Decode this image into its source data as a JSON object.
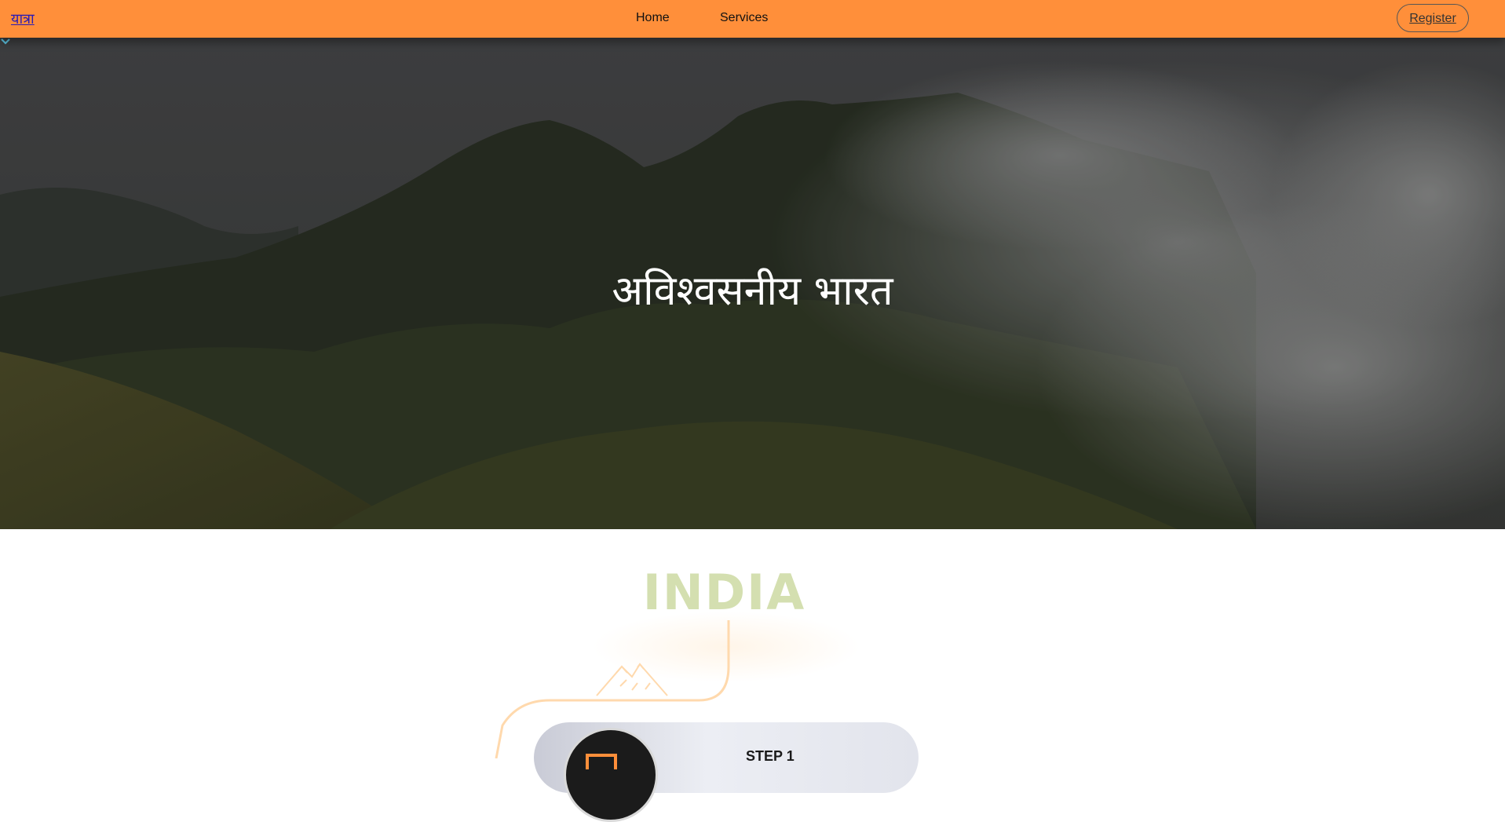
{
  "navbar": {
    "brand": "यात्रा",
    "links": [
      "Home",
      "Services"
    ],
    "register_label": "Register",
    "background": "#ff8f3a"
  },
  "hero": {
    "title": "अविश्वसनीय भारत",
    "scroll_icon": "chevron-down-icon",
    "scroll_icon_color": "#5bc0de"
  },
  "section": {
    "title": "INDIA",
    "title_color": "#d4dfb0",
    "accent": "#ffd9ad"
  },
  "steps": [
    {
      "label": "STEP 1",
      "icon": "ticket-icon"
    }
  ]
}
